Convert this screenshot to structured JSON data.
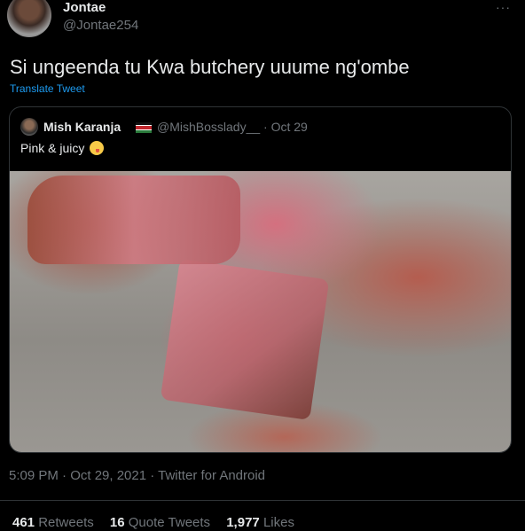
{
  "author": {
    "name": "Jontae",
    "handle": "@Jontae254"
  },
  "more_label": "···",
  "tweet_text": "Si ungeenda tu Kwa butchery uuume ng'ombe",
  "translate_label": "Translate Tweet",
  "quoted_tweet": {
    "name": "Mish Karanja",
    "handle_date": "@MishBosslady__ · Oct 29",
    "text": "Pink & juicy",
    "emoji": "face-savoring-food",
    "flag": "kenya-flag",
    "image_alt": "steak"
  },
  "meta": "5:09 PM · Oct 29, 2021 · Twitter for Android",
  "stats": {
    "retweets_count": "461",
    "retweets_label": "Retweets",
    "quote_count": "16",
    "quote_label": "Quote Tweets",
    "likes_count": "1,977",
    "likes_label": "Likes"
  },
  "colors": {
    "background": "#000000",
    "link": "#1d9bf0",
    "muted": "#71767b",
    "text": "#e7e9ea"
  }
}
